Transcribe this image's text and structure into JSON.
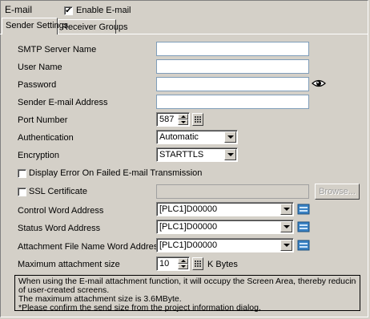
{
  "header": {
    "title": "E-mail",
    "enable_checkbox": {
      "label": "Enable E-mail",
      "checked": true,
      "mark": "✔"
    }
  },
  "tabs": [
    {
      "label": "Sender Settings",
      "active": true
    },
    {
      "label": "Receiver Groups",
      "active": false
    }
  ],
  "form": {
    "smtp_server": {
      "label": "SMTP Server Name",
      "value": ""
    },
    "user_name": {
      "label": "User Name",
      "value": ""
    },
    "password": {
      "label": "Password",
      "value": "",
      "icon": "eye-icon"
    },
    "sender_address": {
      "label": "Sender E-mail Address",
      "value": ""
    },
    "port": {
      "label": "Port Number",
      "value": "587"
    },
    "authentication": {
      "label": "Authentication",
      "value": "Automatic"
    },
    "encryption": {
      "label": "Encryption",
      "value": "STARTTLS"
    },
    "display_error": {
      "label": "Display Error On Failed E-mail Transmission",
      "checked": false
    },
    "ssl_certificate": {
      "label": "SSL Certificate",
      "checked": false,
      "value": "",
      "browse_label": "Browse..."
    },
    "control_word": {
      "label": "Control Word Address",
      "value": "[PLC1]D00000"
    },
    "status_word": {
      "label": "Status Word Address",
      "value": "[PLC1]D00000"
    },
    "attachment_name_word": {
      "label": "Attachment File Name Word Address",
      "value": "[PLC1]D00000"
    },
    "max_attachment": {
      "label": "Maximum attachment size",
      "value": "10",
      "unit": "K Bytes"
    }
  },
  "note": {
    "lines": [
      "When using the E-mail attachment function, it will occupy the Screen Area, thereby reducing the capacity",
      "of user-created screens.",
      "The maximum attachment size is 3.6MByte.",
      "*Please confirm the send size from  the project information dialog."
    ]
  },
  "colors": {
    "background": "#d4d0c8",
    "field_border": "#7f9db9",
    "address_icon": "#3a82c4"
  }
}
